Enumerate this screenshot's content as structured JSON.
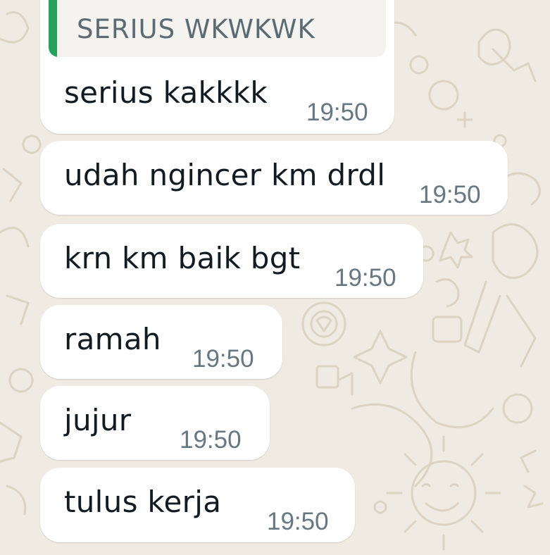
{
  "theme": {
    "wallpaper_color": "#efeae2",
    "bubble_color": "#ffffff",
    "quote_bar_color": "#25a35a",
    "text_color": "#111b21",
    "time_color": "#667781"
  },
  "messages": [
    {
      "quoted": {
        "text": "SERIUS WKWKWK"
      },
      "text": "serius kakkkk",
      "time": "19:50"
    },
    {
      "text": "udah ngincer km drdl",
      "time": "19:50"
    },
    {
      "text": "krn km baik bgt",
      "time": "19:50"
    },
    {
      "text": "ramah",
      "time": "19:50"
    },
    {
      "text": "jujur",
      "time": "19:50"
    },
    {
      "text": "tulus kerja",
      "time": "19:50"
    }
  ]
}
